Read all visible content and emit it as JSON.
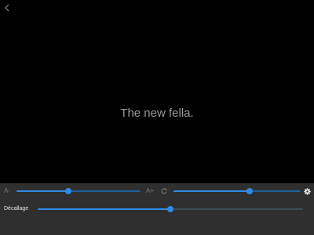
{
  "subtitle": {
    "text": "The new fella."
  },
  "controls": {
    "font_decrease_label": "A-",
    "font_increase_label": "A+",
    "font_size_level": 0.42,
    "color_level": 0.6,
    "offset_label": "Décallage",
    "offset_level": 0.5
  },
  "icons": {
    "back": "chevron-left-icon",
    "color": "color-cycle-icon",
    "settings": "gear-icon"
  },
  "colors": {
    "background": "#000000",
    "panel": "#2f2f2f",
    "accent": "#2e8be6",
    "subtitle_text": "#9a9a9a"
  }
}
